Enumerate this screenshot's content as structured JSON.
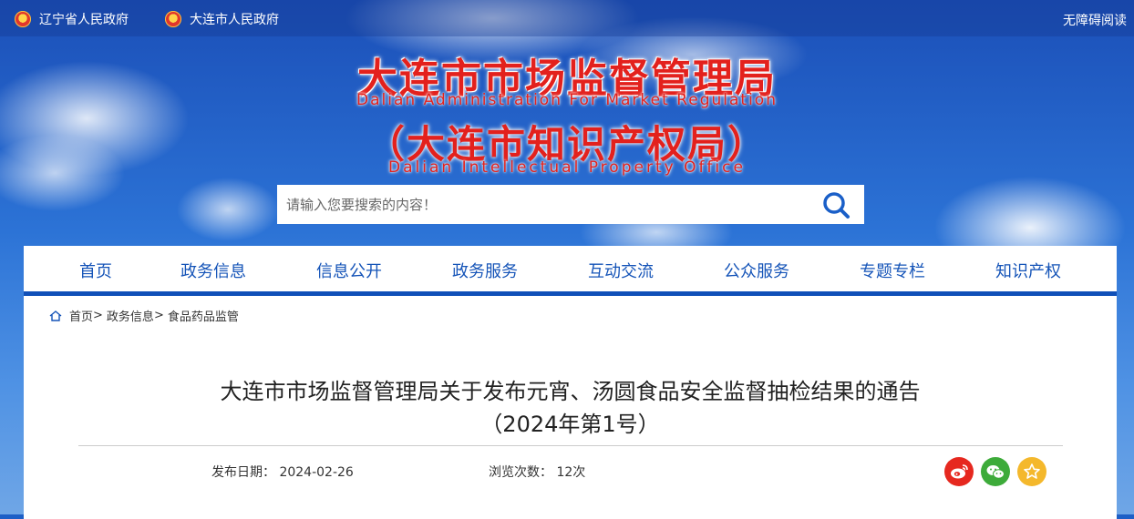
{
  "topbar": {
    "links": [
      {
        "label": "辽宁省人民政府"
      },
      {
        "label": "大连市人民政府"
      }
    ],
    "accessibility": "无障碍阅读"
  },
  "header": {
    "title_cn": "大连市市场监督管理局",
    "title_en": "Dalian Administration For Market Regulation",
    "subtitle_cn": "（大连市知识产权局）",
    "subtitle_en": "Dalian Intellectual Property Office"
  },
  "search": {
    "placeholder": "请输入您要搜索的内容！",
    "icon": "search-icon"
  },
  "nav": {
    "items": [
      {
        "label": "首页"
      },
      {
        "label": "政务信息"
      },
      {
        "label": "信息公开"
      },
      {
        "label": "政务服务"
      },
      {
        "label": "互动交流"
      },
      {
        "label": "公众服务"
      },
      {
        "label": "专题专栏"
      },
      {
        "label": "知识产权"
      }
    ]
  },
  "breadcrumb": {
    "items": [
      "首页",
      "政务信息",
      "食品药品监管"
    ],
    "separator": ">"
  },
  "article": {
    "title_line1": "大连市市场监督管理局关于发布元宵、汤圆食品安全监督抽检结果的通告",
    "title_line2": "（2024年第1号）",
    "date_label": "发布日期：",
    "date_value": "2024-02-26",
    "views_label": "浏览次数：",
    "views_value": "12次"
  },
  "share": {
    "weibo_color": "#e6281f",
    "wechat_color": "#3dab3a",
    "favorite_color": "#f4b82c"
  },
  "colors": {
    "brand_red": "#e3211d",
    "nav_blue": "#1554b8"
  }
}
